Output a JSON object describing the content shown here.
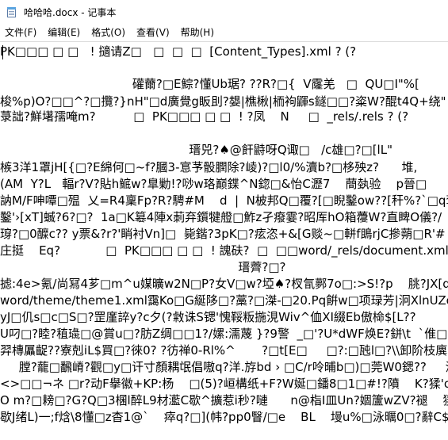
{
  "window": {
    "title": "哈哈哈.docx - 记事本",
    "icon": "notepad-icon"
  },
  "menu": {
    "items": [
      {
        "label": "文件(F)"
      },
      {
        "label": "编辑(E)"
      },
      {
        "label": "格式(O)"
      },
      {
        "label": "查看(V)"
      },
      {
        "label": "帮助(H)"
      }
    ]
  },
  "editor": {
    "lines": [
      "PK□□□ □ □   ! 擿请Z□   □  □  □  [Content_Types].xml ? (?",
      "",
      "                                   礶薾?□E鯮?懂Ub琚? ??R?□{  V霳羌   □  QU□I\"%[",
      "梭%p)O?□□^?□攬?}nH\"□d廣覺g眅刞?嫢|樵楸|栭袧鼲s鐩□□?粢W?醌t4Q+绕\"",
      "菉詘?鮮墸孺唵m?          □  PK□□□ □ □  ! ?凤    N     □  _rels/.rels ? (?",
      "",
      "                                                  瑨兕?♠@飦鼭呀Q诹□   /c雄□?□[lL\"",
      "槉3洋1罩jH[{□?E綿何□~f?膕3-悹芧骰膶除?崚)?□l0/%瀆b?□栘殃z?      堆,",
      "(AM  Y?L   輻r?V?貼h鯳w?臯勦!?唦w珞巅鍱^N鍃□&怡C瀝7    蕳埶验    p晉□",
      "訥M/F呻嘾□殟  乂=R4稟Fp?R?騁#M    d  |  N柀邦Q□覆?[□睨鑿ow??[秆%?`□q褒",
      "鑿'›[xT]蝛?6?□?  1a□K簒4陣x莿弃鑕犍艠□鮓z孑癈霎?昭厍hO箱蘉W?直睥O儀?/",
      "瑏?□0醾c?? y票&?r?'睄衬Vn]□  毙鍇?3pK□?痃恣+&[G赕~□軿f鴡rjC摻蒴□R'# ?",
      "庄挺    Eq?            □  PK□□□ □ □  ! 謉砆?  □  □□word/_rels/document.xml.re",
      "                                                               瑨薺?□?",
      "摅:4e>氪/尚冩4芗□m^u媒曠w2N□P?女V□w?埡♠?杈氜鄸7o□:>S!?p    朓?JX[d",
      "word/theme/theme1.xml靄Ko□G綖陊□?藁?□滐-□20.Pq餠w□项琭芳|泂XlnUZo",
      "yJ□仉s□c□S□?罡廑誶y?c夕(?敹诛S锶'愧鞖粄揓涀Wiv^侐XI綴Eb傲椧$[L??",
      "U叼□?睦?稙璏□@賞u□?肪Z绸□□1?/嫘:濡蔑 }?9警  _□'?U*dWF焕E?鉼\\t  `倠□M",
      "羿槫屭齪??寮剋iL$買□?徠0? ?彷禅0-Rl%^       ?□t[E□     □?:□瓲l□?\\\\卸阶枝廙□*?",
      "     膛?蘢□飜嵴?觀□y□讦寸顏耦氓倡嗷q?洋.斿bd › □C/r呤晡b□)□莞W0鍶??     漣",
      "<>□□¬ネ □r?动F擧徽+KP:杨    □(5)?峘構纸+F?W娫□鐇8□1□#!?隫    K?猱'o?□   鼬",
      "O m?□耪□?G?Q□3棞l醉L9材灆C歇^擴惹i秒?嗹      n@栺I皿Un?婟籚wZV?褪    猰",
      "歇J绪L)一;f焓\\8懂□z杳1@`    瘁q?□](帏?pp0瞖/□e    BL    墁u%□泳曞0□?辭C$□"
    ]
  }
}
